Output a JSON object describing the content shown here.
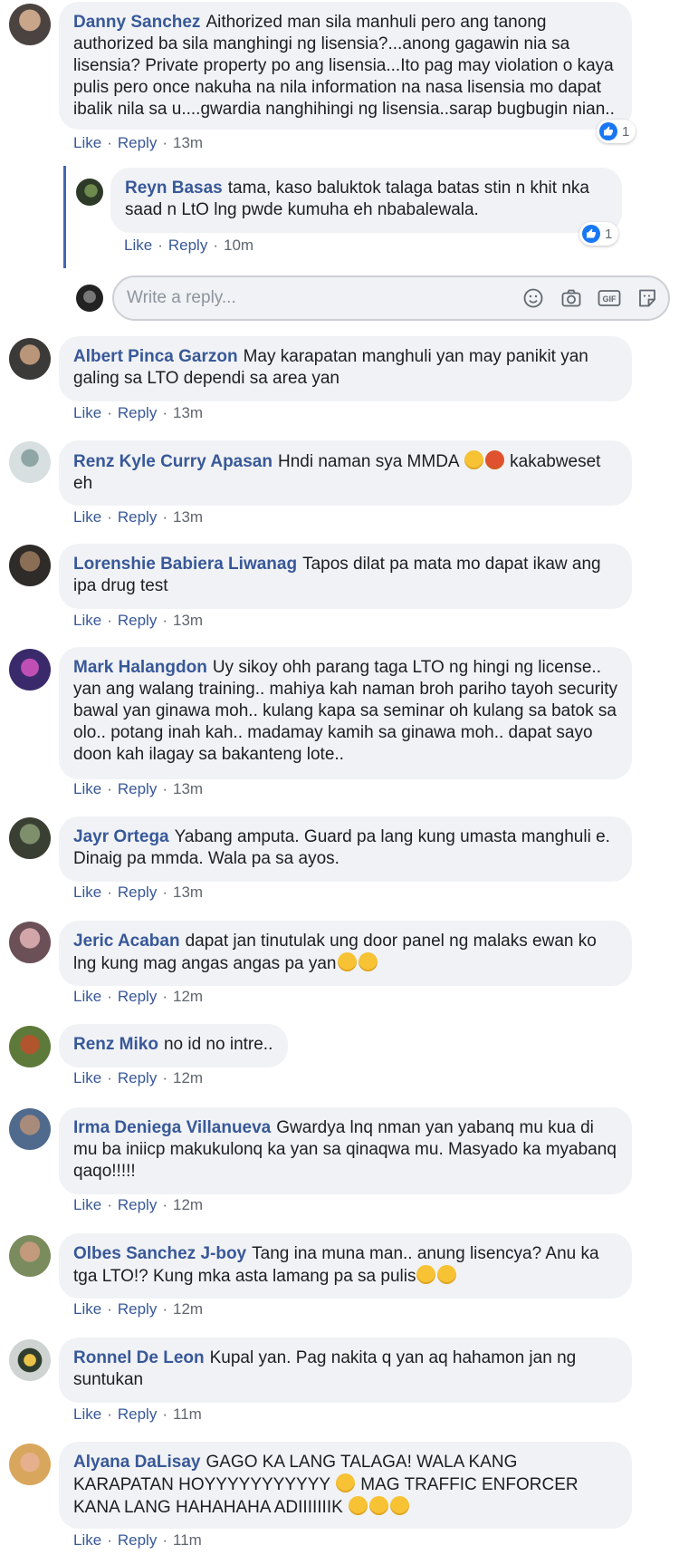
{
  "labels": {
    "like": "Like",
    "reply": "Reply",
    "separator": "·"
  },
  "colors": {
    "author": "#385898",
    "bubble": "#f0f2f5",
    "like_badge": "#1877f2",
    "thread_line": "#4267b2"
  },
  "reply_composer": {
    "placeholder": "Write a reply...",
    "icons": [
      "emoji-icon",
      "camera-icon",
      "gif-icon",
      "sticker-icon"
    ]
  },
  "comments": [
    {
      "author": "Danny Sanchez",
      "text": "Aithorized man sila manhuli pero ang tanong authorized ba sila manghingi ng lisensia?...anong gagawin nia sa lisensia? Private property po ang lisensia...Ito pag may violation o kaya pulis pero once nakuha na nila information na nasa lisensia mo dapat ibalik nila sa u....gwardia nanghihingi ng lisensia..sarap bugbugin nian..",
      "time": "13m",
      "reactions": "1"
    },
    {
      "author": "Reyn Basas",
      "text": "tama, kaso baluktok talaga batas stin n khit nka saad n LtO lng pwde kumuha eh nbabalewala.",
      "time": "10m",
      "reactions": "1"
    },
    {
      "author": "Albert Pinca Garzon",
      "text": "May karapatan manghuli yan may panikit yan galing sa LTO dependi sa area yan",
      "time": "13m"
    },
    {
      "author": "Renz Kyle Curry Apasan",
      "text_before": "Hndi naman sya MMDA",
      "text_after": "kakabweset eh",
      "time": "13m"
    },
    {
      "author": "Lorenshie Babiera Liwanag",
      "text": "Tapos dilat pa mata mo dapat ikaw ang ipa drug test",
      "time": "13m"
    },
    {
      "author": "Mark Halangdon",
      "text": "Uy sikoy ohh parang taga LTO ng hingi ng license.. yan ang walang training.. mahiya kah naman broh pariho tayoh security bawal yan ginawa moh.. kulang kapa sa seminar oh kulang sa batok sa olo.. potang inah kah.. madamay kamih sa ginawa moh.. dapat sayo doon kah ilagay sa bakanteng lote..",
      "time": "13m"
    },
    {
      "author": "Jayr Ortega",
      "text": "Yabang amputa. Guard pa lang kung umasta manghuli e. Dinaig pa mmda. Wala pa sa ayos.",
      "time": "13m"
    },
    {
      "author": "Jeric Acaban",
      "text": "dapat jan tinutulak ung door panel ng malaks ewan ko lng kung mag angas angas pa yan",
      "time": "12m"
    },
    {
      "author": "Renz Miko",
      "text": "no id no intre..",
      "time": "12m"
    },
    {
      "author": "Irma Deniega Villanueva",
      "text": "Gwardya lnq nman yan yabanq mu kua di mu ba iniicp makukulonq ka yan sa qinaqwa mu. Masyado ka myabanq qaqo!!!!!",
      "time": "12m"
    },
    {
      "author": "Olbes Sanchez J-boy",
      "text": "Tang ina muna man.. anung lisencya? Anu ka tga LTO!? Kung mka asta lamang pa sa pulis",
      "time": "12m"
    },
    {
      "author": "Ronnel De Leon",
      "text": "Kupal yan. Pag nakita q yan aq hahamon jan ng suntukan",
      "time": "11m"
    },
    {
      "author": "Alyana DaLisay",
      "text_1": "GAGO KA LANG TALAGA! WALA KANG KARAPATAN HOYYYYYYYYYYY",
      "text_2": "MAG TRAFFIC ENFORCER KANA LANG HAHAHAHA ADIIIIIIIK",
      "time": "11m"
    }
  ]
}
